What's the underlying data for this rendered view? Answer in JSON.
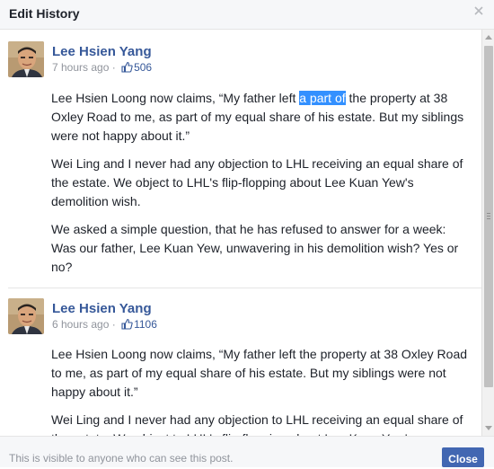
{
  "dialog": {
    "title": "Edit History",
    "close_icon": "close-icon",
    "footer_note": "This is visible to anyone who can see this post.",
    "close_label": "Close"
  },
  "entries": [
    {
      "author": "Lee Hsien Yang",
      "time": "7 hours ago",
      "separator": " · ",
      "likes": "506",
      "like_icon": "thumbs-up-icon",
      "p1_before": "Lee Hsien Loong now claims, “My father left ",
      "p1_highlight": "a part of",
      "p1_after": " the property at 38 Oxley Road to me, as part of my equal share of his estate. But my siblings were not happy about it.”",
      "p2": "Wei Ling and I never had any objection to LHL receiving an equal share of the estate. We object to LHL's flip-flopping about Lee Kuan Yew's demolition wish.",
      "p3": "We asked a simple question, that he has refused to answer for a week: Was our father, Lee Kuan Yew, unwavering in his demolition wish? Yes or no?"
    },
    {
      "author": "Lee Hsien Yang",
      "time": "6 hours ago",
      "separator": " · ",
      "likes": "1106",
      "like_icon": "thumbs-up-icon",
      "p1": "Lee Hsien Loong now claims, “My father left the property at 38 Oxley Road to me, as part of my equal share of his estate. But my siblings were not happy about it.”",
      "p2": "Wei Ling and I never had any objection to LHL receiving an equal share of the estate. We object to LHL's flip-flopping about Lee Kuan Yew's"
    }
  ],
  "colors": {
    "link": "#365899",
    "highlight": "#3390ff",
    "button": "#4267b2"
  }
}
